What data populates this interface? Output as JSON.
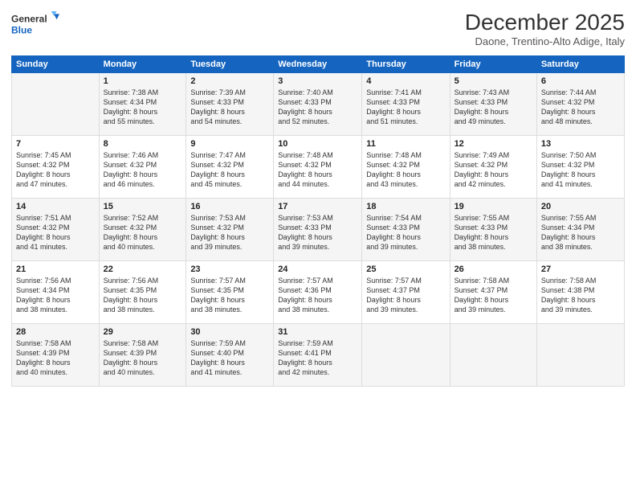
{
  "logo": {
    "line1": "General",
    "line2": "Blue"
  },
  "title": "December 2025",
  "subtitle": "Daone, Trentino-Alto Adige, Italy",
  "weekdays": [
    "Sunday",
    "Monday",
    "Tuesday",
    "Wednesday",
    "Thursday",
    "Friday",
    "Saturday"
  ],
  "weeks": [
    [
      {
        "day": "",
        "info": ""
      },
      {
        "day": "1",
        "info": "Sunrise: 7:38 AM\nSunset: 4:34 PM\nDaylight: 8 hours\nand 55 minutes."
      },
      {
        "day": "2",
        "info": "Sunrise: 7:39 AM\nSunset: 4:33 PM\nDaylight: 8 hours\nand 54 minutes."
      },
      {
        "day": "3",
        "info": "Sunrise: 7:40 AM\nSunset: 4:33 PM\nDaylight: 8 hours\nand 52 minutes."
      },
      {
        "day": "4",
        "info": "Sunrise: 7:41 AM\nSunset: 4:33 PM\nDaylight: 8 hours\nand 51 minutes."
      },
      {
        "day": "5",
        "info": "Sunrise: 7:43 AM\nSunset: 4:33 PM\nDaylight: 8 hours\nand 49 minutes."
      },
      {
        "day": "6",
        "info": "Sunrise: 7:44 AM\nSunset: 4:32 PM\nDaylight: 8 hours\nand 48 minutes."
      }
    ],
    [
      {
        "day": "7",
        "info": "Sunrise: 7:45 AM\nSunset: 4:32 PM\nDaylight: 8 hours\nand 47 minutes."
      },
      {
        "day": "8",
        "info": "Sunrise: 7:46 AM\nSunset: 4:32 PM\nDaylight: 8 hours\nand 46 minutes."
      },
      {
        "day": "9",
        "info": "Sunrise: 7:47 AM\nSunset: 4:32 PM\nDaylight: 8 hours\nand 45 minutes."
      },
      {
        "day": "10",
        "info": "Sunrise: 7:48 AM\nSunset: 4:32 PM\nDaylight: 8 hours\nand 44 minutes."
      },
      {
        "day": "11",
        "info": "Sunrise: 7:48 AM\nSunset: 4:32 PM\nDaylight: 8 hours\nand 43 minutes."
      },
      {
        "day": "12",
        "info": "Sunrise: 7:49 AM\nSunset: 4:32 PM\nDaylight: 8 hours\nand 42 minutes."
      },
      {
        "day": "13",
        "info": "Sunrise: 7:50 AM\nSunset: 4:32 PM\nDaylight: 8 hours\nand 41 minutes."
      }
    ],
    [
      {
        "day": "14",
        "info": "Sunrise: 7:51 AM\nSunset: 4:32 PM\nDaylight: 8 hours\nand 41 minutes."
      },
      {
        "day": "15",
        "info": "Sunrise: 7:52 AM\nSunset: 4:32 PM\nDaylight: 8 hours\nand 40 minutes."
      },
      {
        "day": "16",
        "info": "Sunrise: 7:53 AM\nSunset: 4:32 PM\nDaylight: 8 hours\nand 39 minutes."
      },
      {
        "day": "17",
        "info": "Sunrise: 7:53 AM\nSunset: 4:33 PM\nDaylight: 8 hours\nand 39 minutes."
      },
      {
        "day": "18",
        "info": "Sunrise: 7:54 AM\nSunset: 4:33 PM\nDaylight: 8 hours\nand 39 minutes."
      },
      {
        "day": "19",
        "info": "Sunrise: 7:55 AM\nSunset: 4:33 PM\nDaylight: 8 hours\nand 38 minutes."
      },
      {
        "day": "20",
        "info": "Sunrise: 7:55 AM\nSunset: 4:34 PM\nDaylight: 8 hours\nand 38 minutes."
      }
    ],
    [
      {
        "day": "21",
        "info": "Sunrise: 7:56 AM\nSunset: 4:34 PM\nDaylight: 8 hours\nand 38 minutes."
      },
      {
        "day": "22",
        "info": "Sunrise: 7:56 AM\nSunset: 4:35 PM\nDaylight: 8 hours\nand 38 minutes."
      },
      {
        "day": "23",
        "info": "Sunrise: 7:57 AM\nSunset: 4:35 PM\nDaylight: 8 hours\nand 38 minutes."
      },
      {
        "day": "24",
        "info": "Sunrise: 7:57 AM\nSunset: 4:36 PM\nDaylight: 8 hours\nand 38 minutes."
      },
      {
        "day": "25",
        "info": "Sunrise: 7:57 AM\nSunset: 4:37 PM\nDaylight: 8 hours\nand 39 minutes."
      },
      {
        "day": "26",
        "info": "Sunrise: 7:58 AM\nSunset: 4:37 PM\nDaylight: 8 hours\nand 39 minutes."
      },
      {
        "day": "27",
        "info": "Sunrise: 7:58 AM\nSunset: 4:38 PM\nDaylight: 8 hours\nand 39 minutes."
      }
    ],
    [
      {
        "day": "28",
        "info": "Sunrise: 7:58 AM\nSunset: 4:39 PM\nDaylight: 8 hours\nand 40 minutes."
      },
      {
        "day": "29",
        "info": "Sunrise: 7:58 AM\nSunset: 4:39 PM\nDaylight: 8 hours\nand 40 minutes."
      },
      {
        "day": "30",
        "info": "Sunrise: 7:59 AM\nSunset: 4:40 PM\nDaylight: 8 hours\nand 41 minutes."
      },
      {
        "day": "31",
        "info": "Sunrise: 7:59 AM\nSunset: 4:41 PM\nDaylight: 8 hours\nand 42 minutes."
      },
      {
        "day": "",
        "info": ""
      },
      {
        "day": "",
        "info": ""
      },
      {
        "day": "",
        "info": ""
      }
    ]
  ]
}
